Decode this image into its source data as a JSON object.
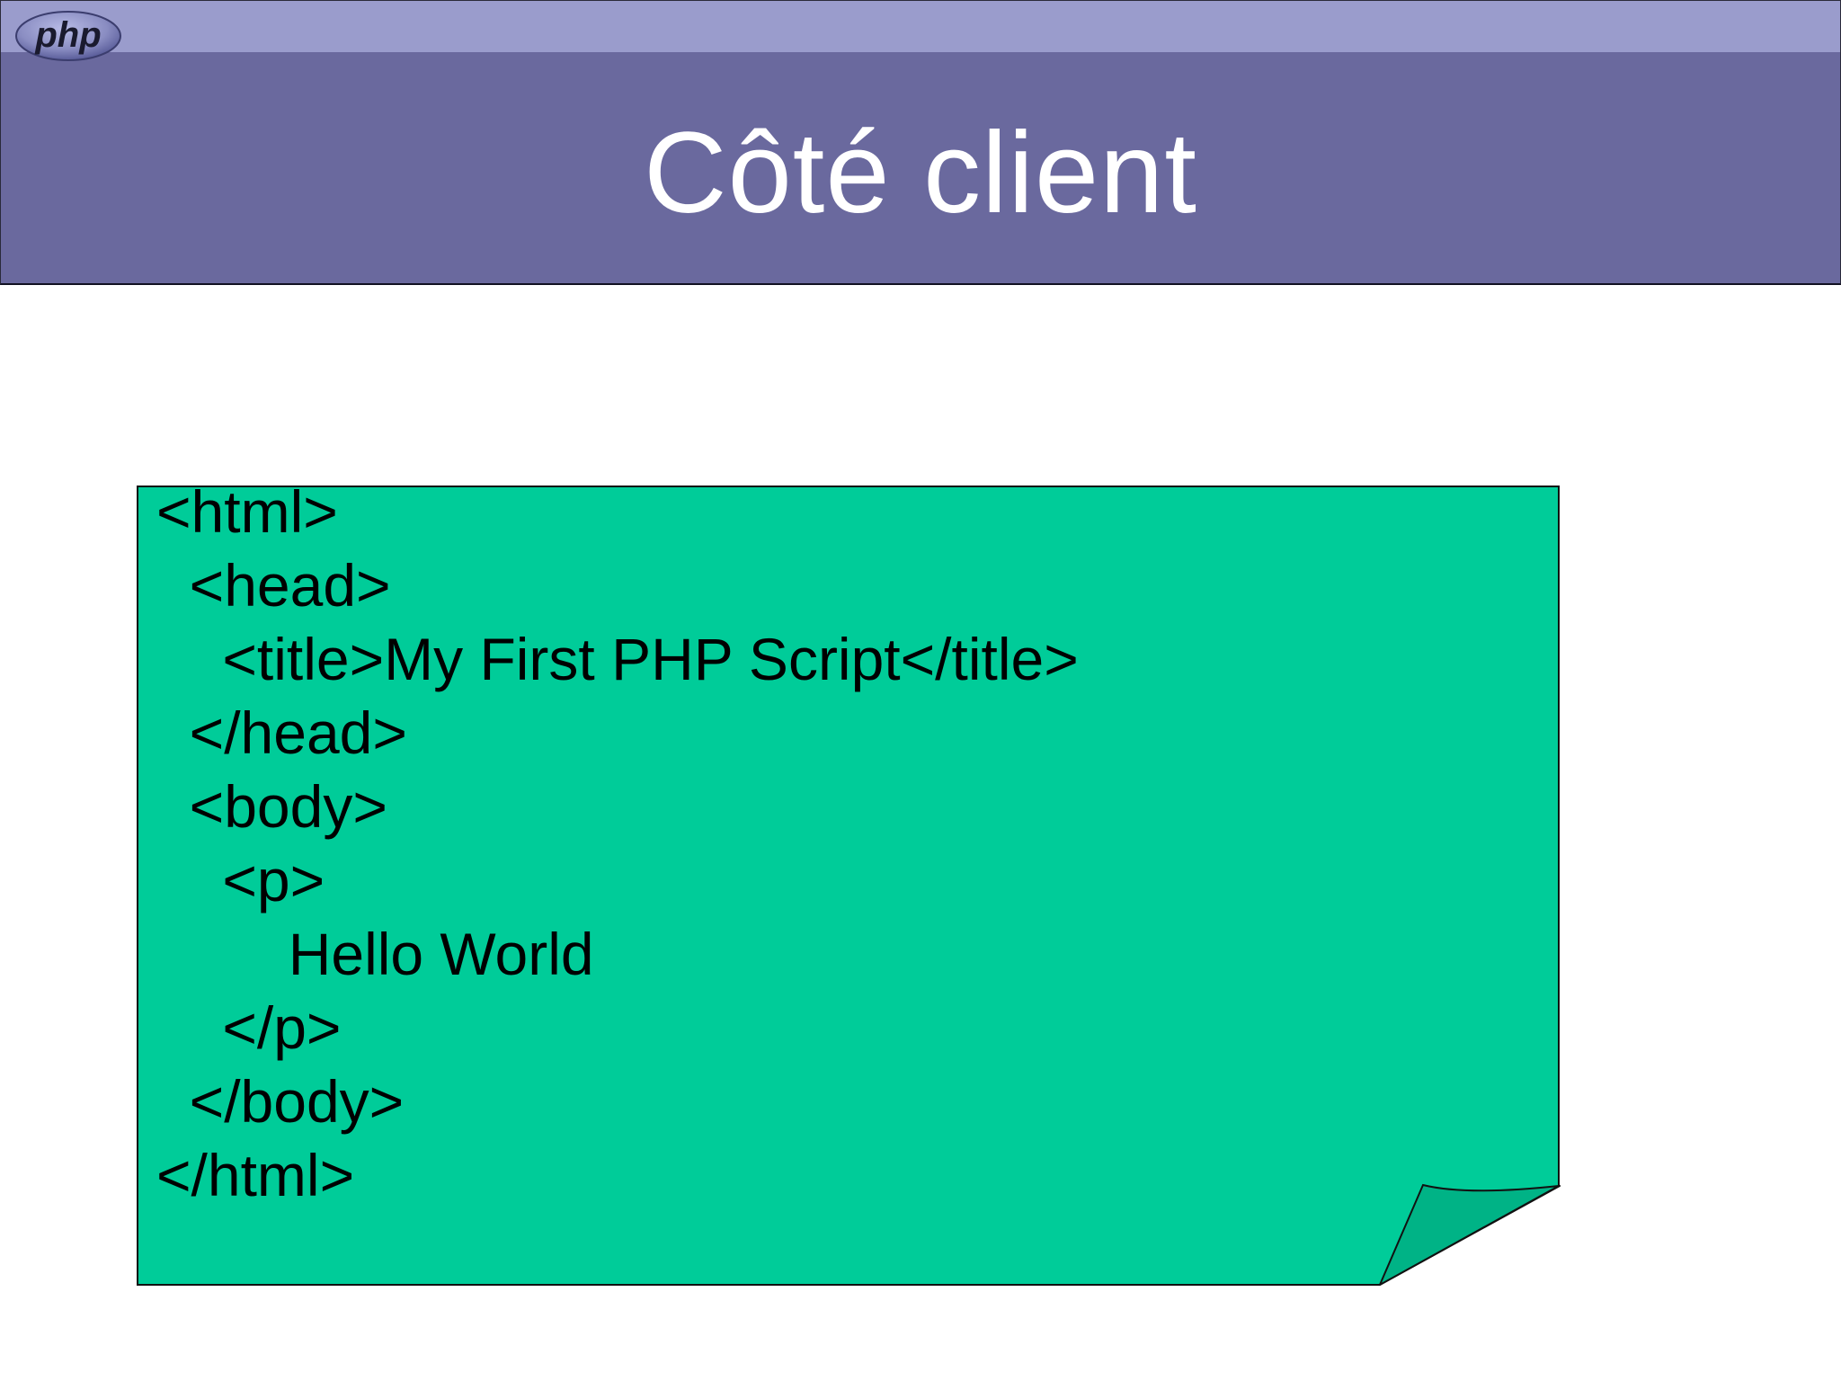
{
  "header": {
    "logo_text": "php",
    "title": "Côté client"
  },
  "colors": {
    "top_band": "#9a9ccc",
    "title_band": "#6a699e",
    "note_fill": "#00cc99",
    "note_fold": "#00b386"
  },
  "code_lines": [
    "<html>",
    "  <head>",
    "    <title>My First PHP Script</title>",
    "  </head>",
    "  <body>",
    "    <p>",
    "        Hello World",
    "    </p>",
    "  </body>",
    "</html>"
  ]
}
